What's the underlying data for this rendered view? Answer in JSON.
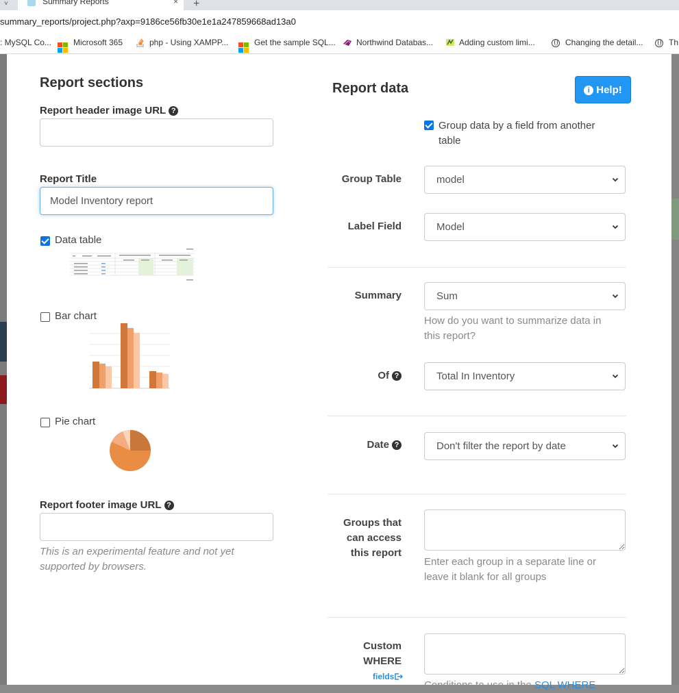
{
  "browser": {
    "tab_title": "Summary Reports",
    "url": "summary_reports/project.php?axp=9186ce56fb30e1e1a247859668ad13a0",
    "bookmarks": [
      {
        "label": ": MySQL Co...",
        "icon": "none"
      },
      {
        "label": "Microsoft 365",
        "icon": "microsoft-icon"
      },
      {
        "label": "php - Using XAMPP...",
        "icon": "stackoverflow-icon"
      },
      {
        "label": "Get the sample SQL...",
        "icon": "microsoft-icon"
      },
      {
        "label": "Northwind Databas...",
        "icon": "northwind-icon"
      },
      {
        "label": "Adding custom limi...",
        "icon": "custom-icon"
      },
      {
        "label": "Changing the detail...",
        "icon": "globe-icon"
      },
      {
        "label": "Th",
        "icon": "globe-icon"
      }
    ]
  },
  "left": {
    "title": "Report sections",
    "header_image_label": "Report header image URL",
    "header_image_value": "",
    "report_title_label": "Report Title",
    "report_title_value": "Model Inventory report",
    "data_table_label": "Data table",
    "data_table_checked": true,
    "bar_chart_label": "Bar chart",
    "bar_chart_checked": false,
    "pie_chart_label": "Pie chart",
    "pie_chart_checked": false,
    "footer_image_label": "Report footer image URL",
    "footer_image_value": "",
    "footer_hint_1": "This is an experimental feature and not yet",
    "footer_hint_2": "supported by browsers."
  },
  "right": {
    "title": "Report data",
    "help_label": "Help!",
    "group_data_label_1": "Group data by a field from another",
    "group_data_label_2": "table",
    "group_data_checked": true,
    "group_table_label": "Group Table",
    "group_table_value": "model",
    "label_field_label": "Label Field",
    "label_field_value": "Model",
    "summary_label": "Summary",
    "summary_value": "Sum",
    "summary_hint_1": "How do you want to summarize data in",
    "summary_hint_2": "this report?",
    "of_label": "Of",
    "of_value": "Total In Inventory",
    "date_label": "Date",
    "date_value": "Don't filter the report by date",
    "groups_label_1": "Groups that",
    "groups_label_2": "can access",
    "groups_label_3": "this report",
    "groups_hint_1": "Enter each group in a separate line or",
    "groups_hint_2": "leave it blank for all groups",
    "where_label_1": "Custom",
    "where_label_2": "WHERE",
    "fields_link": "fields",
    "where_hint_prefix": "Conditions to use in the ",
    "where_hint_link": "SQL WHERE"
  },
  "colors": {
    "primary_blue": "#2196f3",
    "checkbox_blue": "#0b74e5",
    "chart_dark": "#d2773a",
    "chart_mid": "#f0a06a",
    "chart_light": "#fcc7a4"
  }
}
